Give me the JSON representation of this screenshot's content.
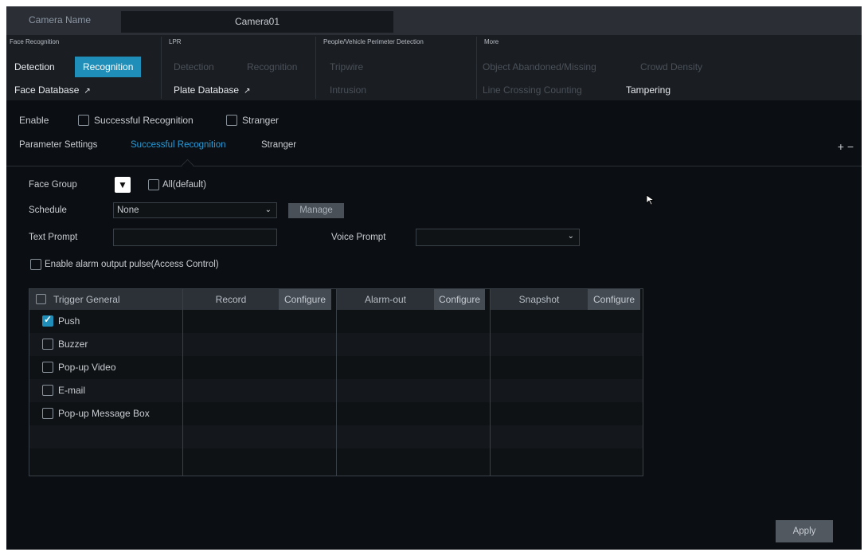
{
  "header": {
    "camera_name_label": "Camera Name",
    "camera_name_value": "Camera01"
  },
  "menu": {
    "face_recognition": {
      "title": "Face Recognition",
      "detection": "Detection",
      "recognition": "Recognition",
      "database": "Face Database"
    },
    "lpr": {
      "title": "LPR",
      "detection": "Detection",
      "recognition": "Recognition",
      "database": "Plate Database"
    },
    "perimeter": {
      "title": "People/Vehicle Perimeter Detection",
      "tripwire": "Tripwire",
      "intrusion": "Intrusion"
    },
    "more": {
      "title": "More",
      "object": "Object Abandoned/Missing",
      "crowd": "Crowd Density",
      "line_crossing": "Line Crossing Counting",
      "tampering": "Tampering"
    }
  },
  "enable_row": {
    "enable": "Enable",
    "successful": "Successful Recognition",
    "stranger": "Stranger"
  },
  "tabs": {
    "parameter": "Parameter Settings",
    "successful": "Successful Recognition",
    "stranger": "Stranger",
    "add_remove": "+ −"
  },
  "form": {
    "face_group": "Face Group",
    "all_default": "All(default)",
    "schedule": "Schedule",
    "schedule_value": "None",
    "manage": "Manage",
    "text_prompt": "Text Prompt",
    "voice_prompt": "Voice Prompt",
    "alarm_pulse": "Enable alarm output pulse(Access Control)"
  },
  "table": {
    "trigger_general": "Trigger General",
    "record": "Record",
    "alarm_out": "Alarm-out",
    "snapshot": "Snapshot",
    "configure": "Configure",
    "rows": [
      "Push",
      "Buzzer",
      "Pop-up Video",
      "E-mail",
      "Pop-up Message Box"
    ],
    "push_checked": true
  },
  "apply": "Apply",
  "colors": {
    "accent": "#1f8fb9",
    "tab_active": "#2a9cd8",
    "background": "#0b0e12"
  }
}
